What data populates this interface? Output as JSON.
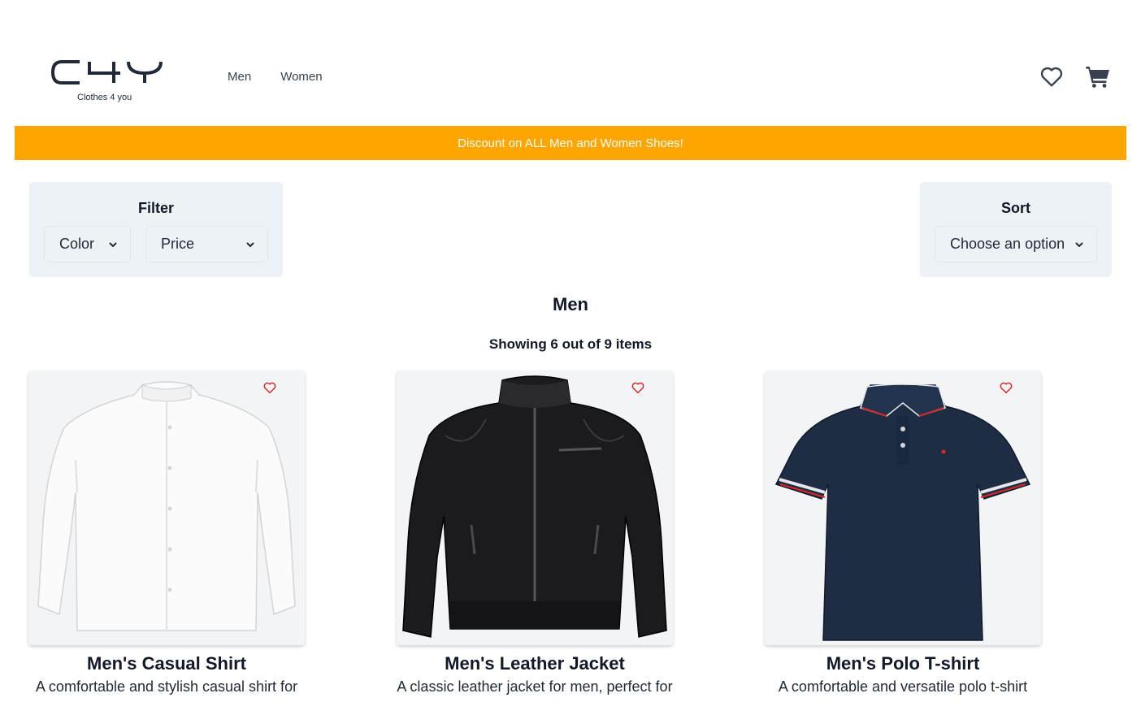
{
  "brand": {
    "logo_text": "C4Y",
    "tagline": "Clothes 4 you"
  },
  "nav": {
    "items": [
      "Men",
      "Women"
    ]
  },
  "header_icons": [
    "heart-icon",
    "cart-icon"
  ],
  "banner": {
    "text": "Discount on ALL Men and Women Shoes!",
    "color": "#ffa500"
  },
  "filter": {
    "title": "Filter",
    "color_label": "Color",
    "price_label": "Price"
  },
  "sort": {
    "title": "Sort",
    "selected": "Choose an option"
  },
  "section": {
    "title": "Men",
    "count_text": "Showing 6 out of 9 items"
  },
  "products": [
    {
      "name": "Men's Casual Shirt",
      "description": "A comfortable and stylish casual shirt for",
      "image": "white-shirt"
    },
    {
      "name": "Men's Leather Jacket",
      "description": "A classic leather jacket for men, perfect for",
      "image": "black-leather-jacket"
    },
    {
      "name": "Men's Polo T-shirt",
      "description": "A comfortable and versatile polo t-shirt",
      "image": "navy-polo-shirt"
    }
  ],
  "colors": {
    "favorite_heart": "#dc2626",
    "panel_bg": "#edf2f7",
    "card_bg": "#f3f4f6"
  }
}
